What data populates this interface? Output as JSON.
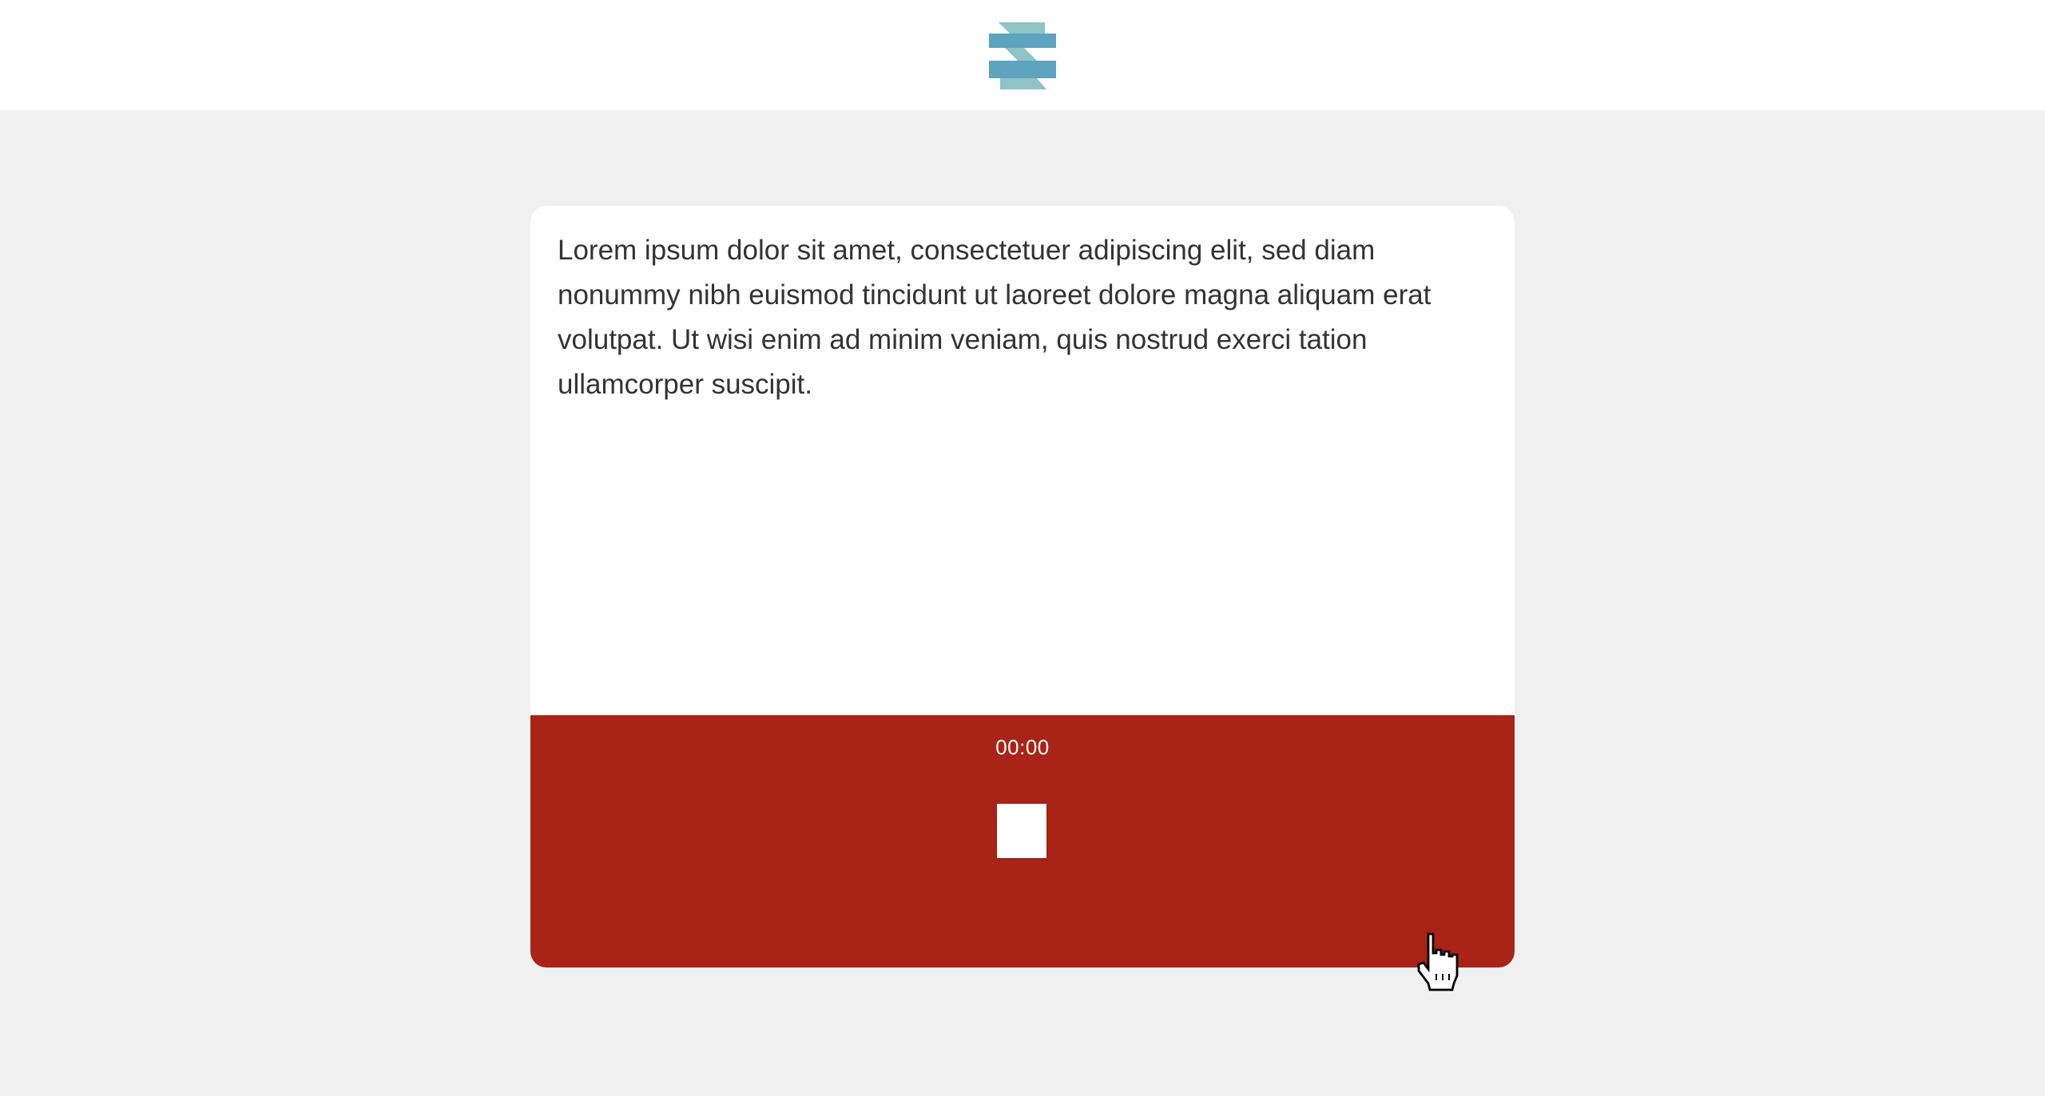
{
  "header": {
    "logo_icon": "striped-s-logo-icon",
    "logo_colors": {
      "bar": "#5ea3bf",
      "diagonal": "#8fc3c6"
    }
  },
  "content": {
    "text": "Lorem ipsum dolor sit amet, consectetuer adipiscing elit, sed diam nonummy nibh euismod tincidunt ut laoreet dolore magna aliquam erat volutpat. Ut wisi enim ad minim veniam, quis nostrud exerci tation ullamcorper suscipit."
  },
  "recorder": {
    "timer": "00:00",
    "stop_icon": "stop-icon",
    "background_color": "#a92316"
  },
  "pointer": {
    "icon": "hand-pointer-cursor-icon"
  }
}
